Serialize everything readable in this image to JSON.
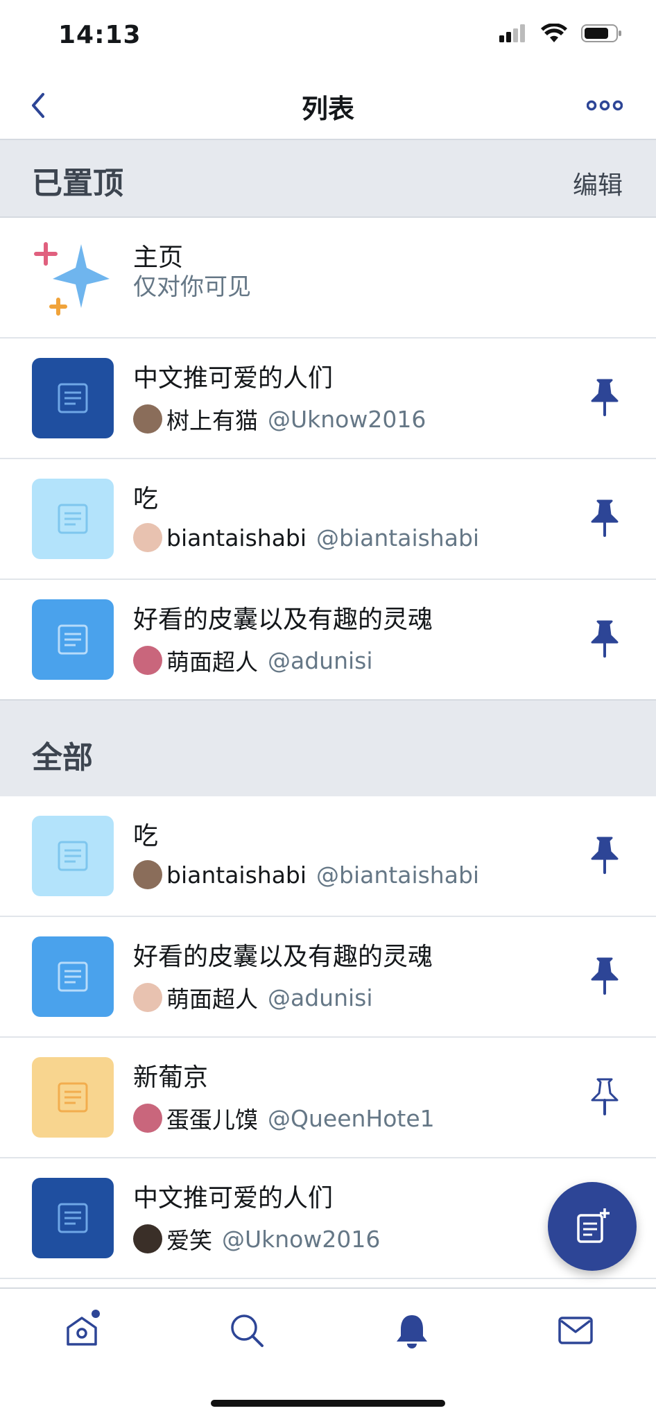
{
  "status": {
    "time": "14:13"
  },
  "nav": {
    "title": "列表"
  },
  "pinned_section": {
    "title": "已置顶",
    "edit_label": "编辑"
  },
  "home": {
    "title": "主页",
    "subtitle": "仅对你可见"
  },
  "all_section": {
    "title": "全部"
  },
  "colors": {
    "accent": "#2d4596",
    "dark_blue": "#1f4fa0",
    "light_blue": "#b3e3fb",
    "mid_blue": "#4aa2ec",
    "yellow": "#f8d58f"
  },
  "pinned_lists": [
    {
      "name": "中文推可爱的人们",
      "owner": "树上有猫",
      "handle": "@Uknow2016",
      "color": "dark",
      "pinned": true
    },
    {
      "name": "吃",
      "owner": "biantaishabi",
      "handle": "@biantaishabi",
      "color": "light",
      "pinned": true
    },
    {
      "name": "好看的皮囊以及有趣的灵魂",
      "owner": "萌面超人",
      "handle": "@adunisi",
      "color": "mid",
      "pinned": true
    }
  ],
  "all_lists": [
    {
      "name": "吃",
      "owner": "biantaishabi",
      "handle": "@biantaishabi",
      "color": "light",
      "pinned": true
    },
    {
      "name": "好看的皮囊以及有趣的灵魂",
      "owner": "萌面超人",
      "handle": "@adunisi",
      "color": "mid",
      "pinned": true
    },
    {
      "name": "新葡京",
      "owner": "蛋蛋儿馍",
      "handle": "@QueenHote1",
      "color": "yellow",
      "pinned": false
    },
    {
      "name": "中文推可爱的人们",
      "owner": "爱笑",
      "handle": "@Uknow2016",
      "color": "dark",
      "pinned": false
    }
  ],
  "tabs": [
    "home-icon",
    "search-icon",
    "bell-icon",
    "mail-icon"
  ]
}
